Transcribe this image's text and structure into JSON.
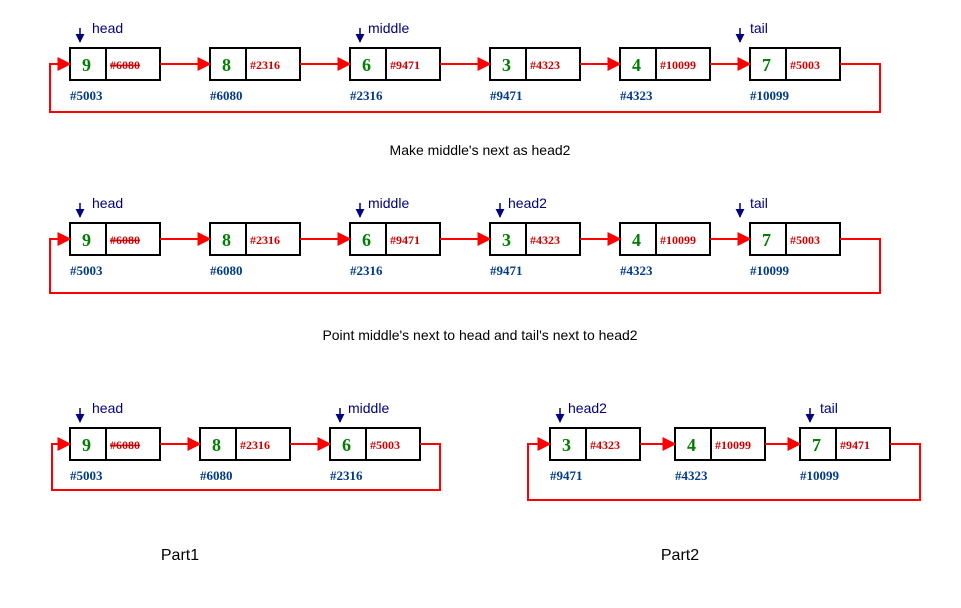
{
  "labels": {
    "head": "head",
    "middle": "middle",
    "head2": "head2",
    "tail": "tail",
    "part1": "Part1",
    "part2": "Part2"
  },
  "captions": {
    "c1": "Make middle's next as head2",
    "c2": "Point middle's next to head and tail's next to head2"
  },
  "row1": [
    {
      "val": "9",
      "ptr": "#6080",
      "addr": "#5003",
      "strike": true
    },
    {
      "val": "8",
      "ptr": "#2316",
      "addr": "#6080"
    },
    {
      "val": "6",
      "ptr": "#9471",
      "addr": "#2316"
    },
    {
      "val": "3",
      "ptr": "#4323",
      "addr": "#9471"
    },
    {
      "val": "4",
      "ptr": "#10099",
      "addr": "#4323"
    },
    {
      "val": "7",
      "ptr": "#5003",
      "addr": "#10099"
    }
  ],
  "row2": [
    {
      "val": "9",
      "ptr": "#6080",
      "addr": "#5003",
      "strike": true
    },
    {
      "val": "8",
      "ptr": "#2316",
      "addr": "#6080"
    },
    {
      "val": "6",
      "ptr": "#9471",
      "addr": "#2316"
    },
    {
      "val": "3",
      "ptr": "#4323",
      "addr": "#9471"
    },
    {
      "val": "4",
      "ptr": "#10099",
      "addr": "#4323"
    },
    {
      "val": "7",
      "ptr": "#5003",
      "addr": "#10099"
    }
  ],
  "row3a": [
    {
      "val": "9",
      "ptr": "#6080",
      "addr": "#5003",
      "strike": true
    },
    {
      "val": "8",
      "ptr": "#2316",
      "addr": "#6080"
    },
    {
      "val": "6",
      "ptr": "#5003",
      "addr": "#2316"
    }
  ],
  "row3b": [
    {
      "val": "3",
      "ptr": "#4323",
      "addr": "#9471"
    },
    {
      "val": "4",
      "ptr": "#10099",
      "addr": "#4323"
    },
    {
      "val": "7",
      "ptr": "#9471",
      "addr": "#10099"
    }
  ]
}
